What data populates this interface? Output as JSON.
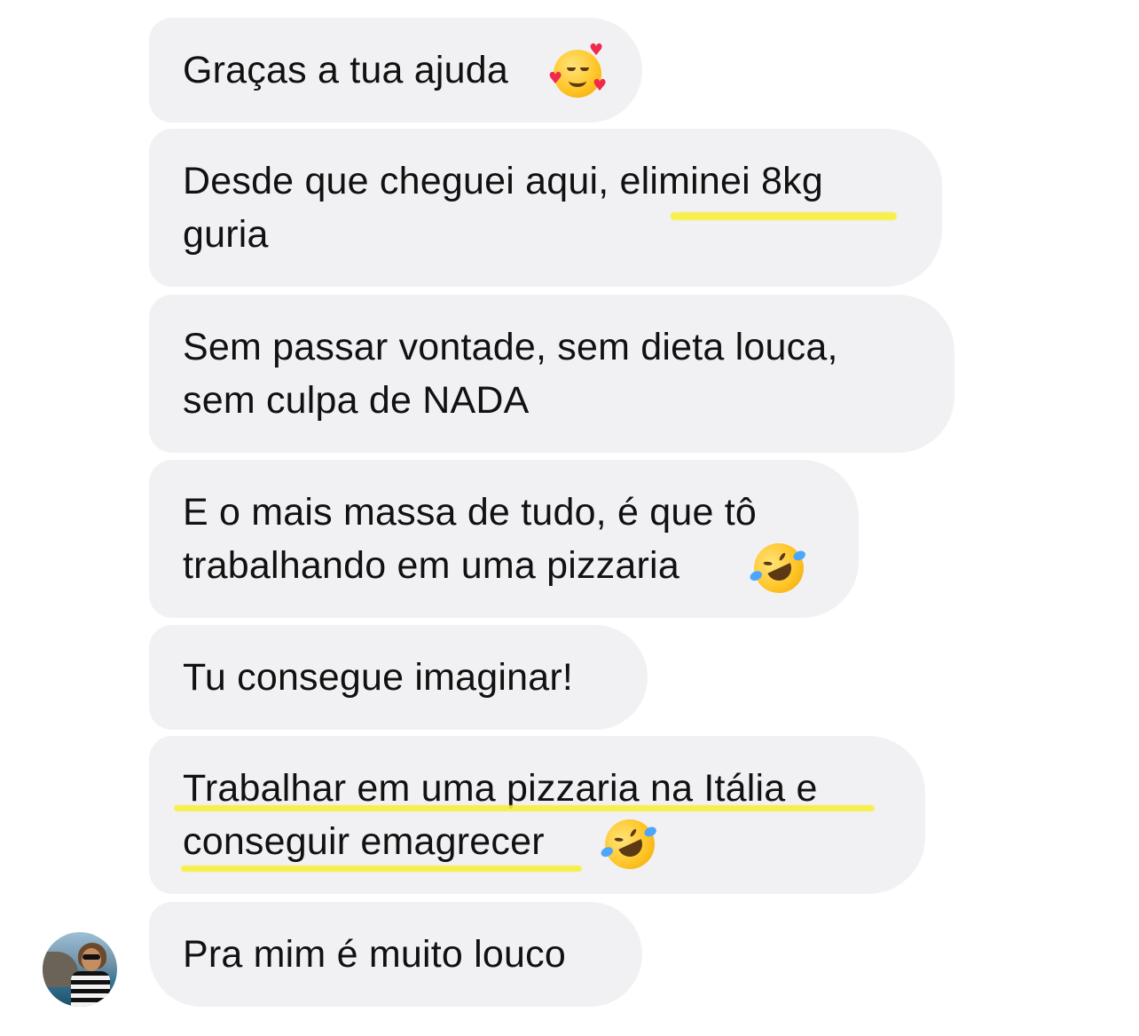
{
  "conversation": {
    "messages": [
      {
        "lines": [
          "Graças a tua ajuda"
        ],
        "emoji": "smiling-face-with-hearts-icon"
      },
      {
        "lines": [
          "Desde que cheguei aqui, eliminei 8kg",
          "guria"
        ]
      },
      {
        "lines": [
          "Sem passar vontade, sem dieta louca,",
          "sem culpa de NADA"
        ]
      },
      {
        "lines": [
          "E o mais massa de tudo, é que tô",
          "trabalhando em uma pizzaria"
        ],
        "emoji": "rolling-on-floor-laughing-icon"
      },
      {
        "lines": [
          "Tu consegue imaginar!"
        ]
      },
      {
        "lines": [
          "Trabalhar em uma pizzaria na Itália e",
          "conseguir emagrecer"
        ],
        "emoji": "rolling-on-floor-laughing-icon"
      },
      {
        "lines": [
          "Pra mim é muito louco"
        ]
      }
    ]
  },
  "colors": {
    "bubble_background": "#f1f1f4",
    "highlight": "#f7ef3a"
  }
}
